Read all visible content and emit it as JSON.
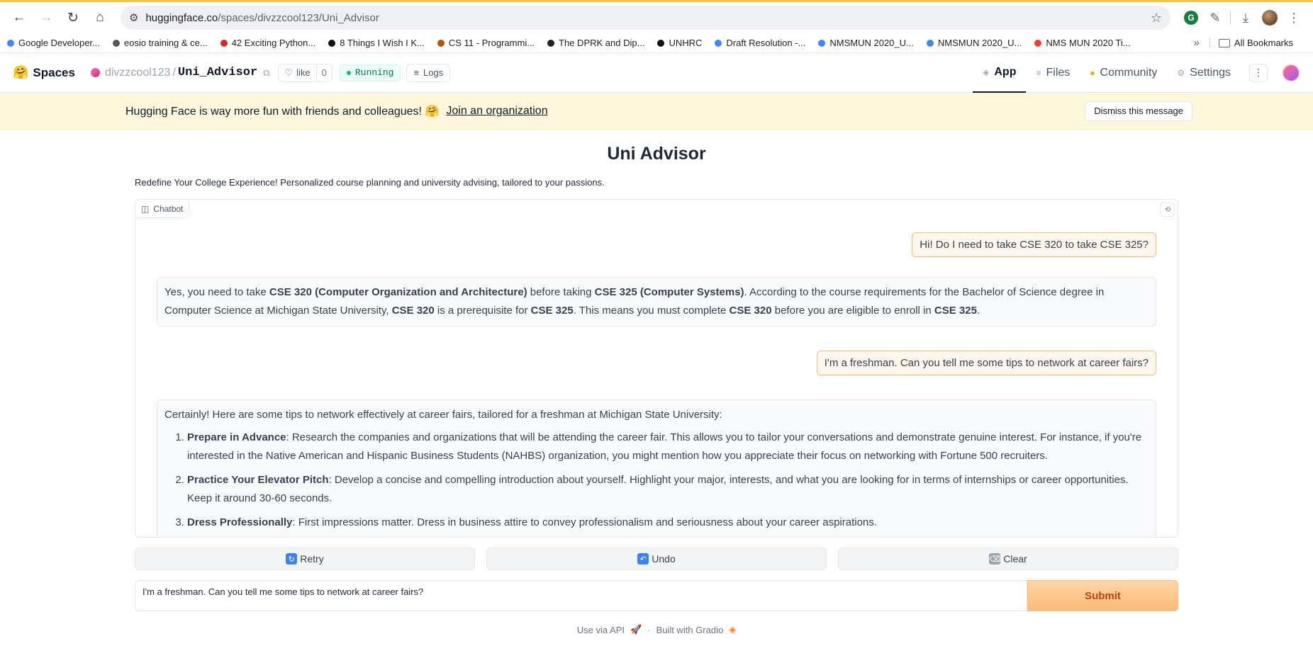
{
  "browser": {
    "url_domain": "huggingface.co",
    "url_path": "/spaces/divzzcool123/Uni_Advisor",
    "bookmarks": [
      {
        "label": "Google Developer...",
        "icon": "google-icon",
        "color": "#4285f4"
      },
      {
        "label": "eosio training & ce...",
        "icon": "eos-icon",
        "color": "#555555"
      },
      {
        "label": "42 Exciting Python...",
        "icon": "bookmark-red-icon",
        "color": "#dc2626"
      },
      {
        "label": "8 Things I Wish I K...",
        "icon": "f-icon",
        "color": "#111111"
      },
      {
        "label": "CS 11 - Programmi...",
        "icon": "cs-icon",
        "color": "#b45309"
      },
      {
        "label": "The DPRK and Dip...",
        "icon": "globe-icon",
        "color": "#222222"
      },
      {
        "label": "UNHRC",
        "icon": "un-icon",
        "color": "#111111"
      },
      {
        "label": "Draft Resolution -...",
        "icon": "docs-icon",
        "color": "#4285f4"
      },
      {
        "label": "NMSMUN 2020_U...",
        "icon": "docs-icon",
        "color": "#4285f4"
      },
      {
        "label": "NMSMUN 2020_U...",
        "icon": "docs-icon",
        "color": "#4285f4"
      },
      {
        "label": "NMS MUN 2020 Ti...",
        "icon": "gmail-icon",
        "color": "#ea4335"
      }
    ],
    "all_bookmarks": "All Bookmarks"
  },
  "hf": {
    "spaces": "Spaces",
    "owner": "divzzcool123",
    "repo": "Uni_Advisor",
    "like_label": "like",
    "like_count": "0",
    "status": "Running",
    "logs": "Logs",
    "tabs": [
      {
        "label": "App",
        "icon": "app-icon"
      },
      {
        "label": "Files",
        "icon": "files-icon"
      },
      {
        "label": "Community",
        "icon": "community-icon"
      },
      {
        "label": "Settings",
        "icon": "gear-icon"
      }
    ]
  },
  "banner": {
    "message": "Hugging Face is way more fun with friends and colleagues! 🤗",
    "join": "Join an organization",
    "dismiss": "Dismiss this message"
  },
  "app": {
    "title": "Uni Advisor",
    "description": "Redefine Your College Experience! Personalized course planning and university advising, tailored to your passions.",
    "chatbot_label": "Chatbot",
    "messages": {
      "user1": "Hi! Do I need to take CSE 320 to take CSE 325?",
      "bot1": {
        "p1": "Yes, you need to take ",
        "b1": "CSE 320 (Computer Organization and Architecture)",
        "p2": " before taking ",
        "b2": "CSE 325 (Computer Systems)",
        "p3": ". According to the course requirements for the Bachelor of Science degree in Computer Science at Michigan State University, ",
        "b3": "CSE 320",
        "p4": " is a prerequisite for ",
        "b4": "CSE 325",
        "p5": ". This means you must complete ",
        "b5": "CSE 320",
        "p6": " before you are eligible to enroll in ",
        "b6": "CSE 325",
        "p7": "."
      },
      "user2": "I'm a freshman. Can you tell me some tips to network at career fairs?",
      "bot2": {
        "intro": "Certainly! Here are some tips to network effectively at career fairs, tailored for a freshman at Michigan State University:",
        "tips": [
          {
            "title": "Prepare in Advance",
            "text": ": Research the companies and organizations that will be attending the career fair. This allows you to tailor your conversations and demonstrate genuine interest. For instance, if you're interested in the Native American and Hispanic Business Students (NAHBS) organization, you might mention how you appreciate their focus on networking with Fortune 500 recruiters."
          },
          {
            "title": "Practice Your Elevator Pitch",
            "text": ": Develop a concise and compelling introduction about yourself. Highlight your major, interests, and what you are looking for in terms of internships or career opportunities. Keep it around 30-60 seconds."
          },
          {
            "title": "Dress Professionally",
            "text": ": First impressions matter. Dress in business attire to convey professionalism and seriousness about your career aspirations."
          }
        ]
      }
    },
    "buttons": {
      "retry": "Retry",
      "undo": "Undo",
      "clear": "Clear",
      "submit": "Submit"
    },
    "input_value": "I'm a freshman. Can you tell me some tips to network at career fairs?",
    "footer": {
      "api": "Use via API",
      "built": "Built with Gradio"
    }
  }
}
